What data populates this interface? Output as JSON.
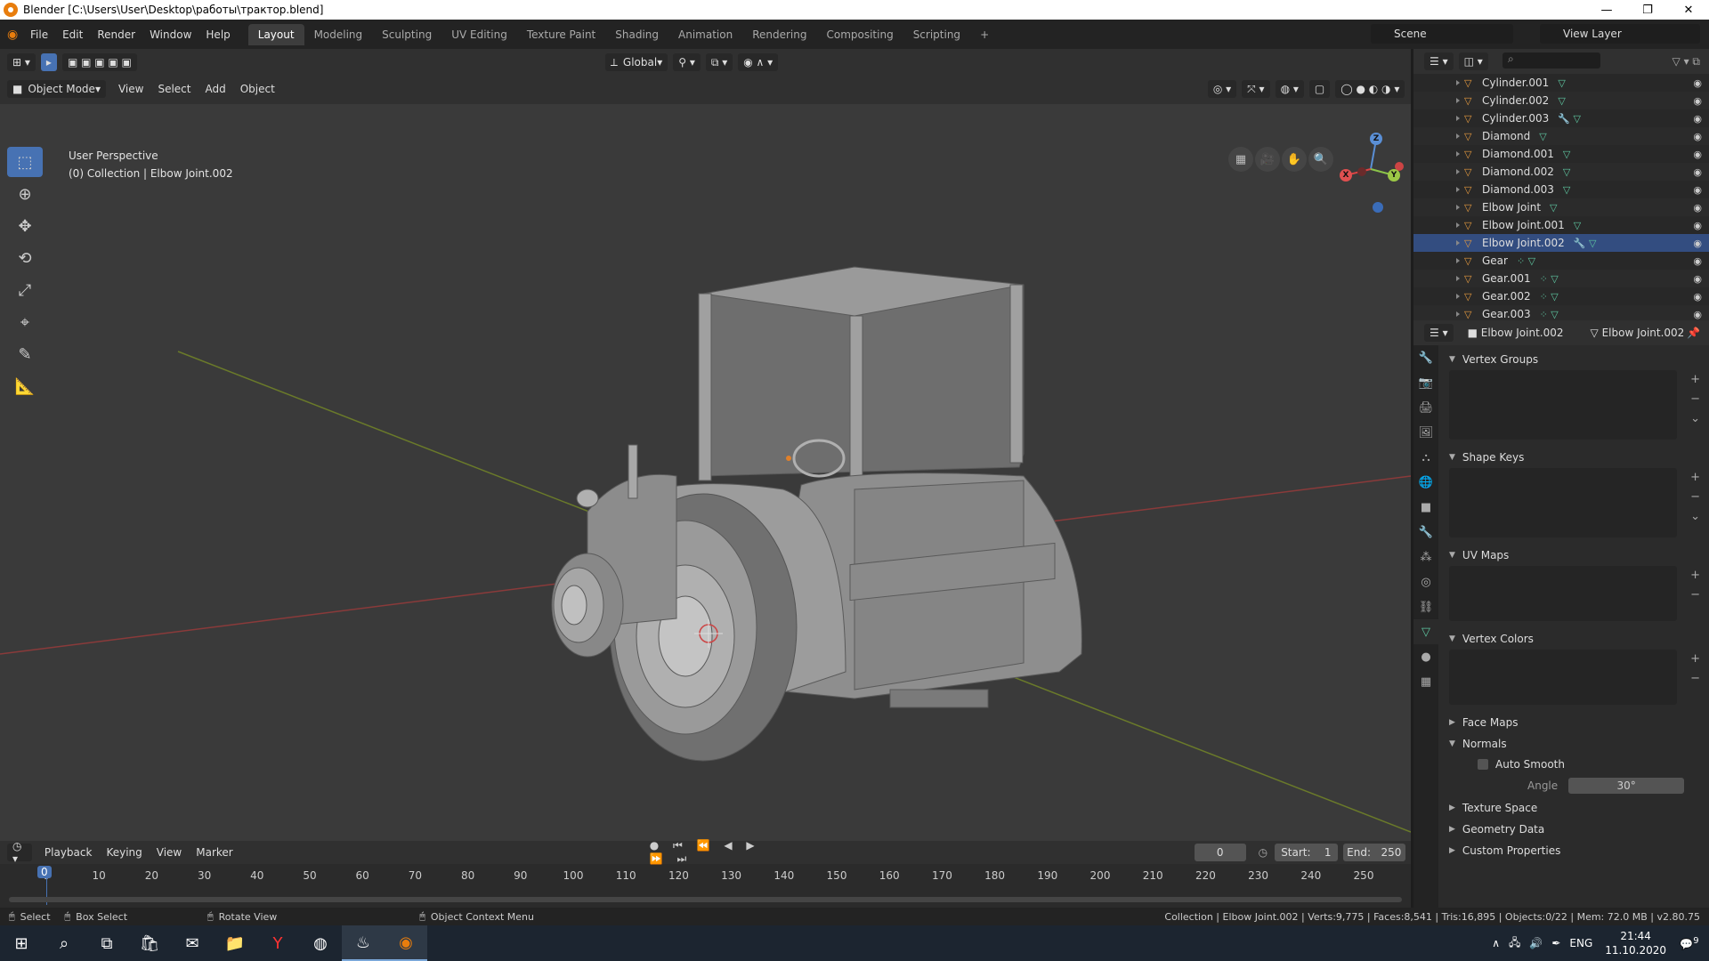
{
  "window": {
    "title": "Blender [C:\\Users\\User\\Desktop\\работы\\трактор.blend]",
    "minimize": "—",
    "maximize": "❐",
    "close": "✕"
  },
  "menu": [
    "File",
    "Edit",
    "Render",
    "Window",
    "Help"
  ],
  "workspaces": [
    "Layout",
    "Modeling",
    "Sculpting",
    "UV Editing",
    "Texture Paint",
    "Shading",
    "Animation",
    "Rendering",
    "Compositing",
    "Scripting"
  ],
  "active_workspace": "Layout",
  "scene": "Scene",
  "view_layer": "View Layer",
  "viewport": {
    "transform_orientation": "Global",
    "mode": "Object Mode",
    "menus": [
      "View",
      "Select",
      "Add",
      "Object"
    ],
    "info_line1": "User Perspective",
    "info_line2": "(0) Collection | Elbow Joint.002",
    "axes": {
      "x": "X",
      "y": "Y",
      "z": "Z"
    }
  },
  "outliner": {
    "items": [
      {
        "name": "Cylinder.001",
        "mods": "▽"
      },
      {
        "name": "Cylinder.002",
        "mods": "▽"
      },
      {
        "name": "Cylinder.003",
        "mods": "🔧 ▽"
      },
      {
        "name": "Diamond",
        "mods": "▽"
      },
      {
        "name": "Diamond.001",
        "mods": "▽"
      },
      {
        "name": "Diamond.002",
        "mods": "▽"
      },
      {
        "name": "Diamond.003",
        "mods": "▽"
      },
      {
        "name": "Elbow Joint",
        "mods": "▽"
      },
      {
        "name": "Elbow Joint.001",
        "mods": "▽"
      },
      {
        "name": "Elbow Joint.002",
        "mods": "🔧 ▽"
      },
      {
        "name": "Gear",
        "mods": "⁘ ▽"
      },
      {
        "name": "Gear.001",
        "mods": "⁘ ▽"
      },
      {
        "name": "Gear.002",
        "mods": "⁘ ▽"
      },
      {
        "name": "Gear.003",
        "mods": "⁘ ▽"
      }
    ]
  },
  "properties": {
    "object_name": "Elbow Joint.002",
    "mesh_name": "Elbow Joint.002",
    "panels": {
      "vertex_groups": "Vertex Groups",
      "shape_keys": "Shape Keys",
      "uv_maps": "UV Maps",
      "vertex_colors": "Vertex Colors",
      "face_maps": "Face Maps",
      "normals": "Normals",
      "auto_smooth": "Auto Smooth",
      "angle_label": "Angle",
      "angle_value": "30°",
      "texture_space": "Texture Space",
      "geometry_data": "Geometry Data",
      "custom_properties": "Custom Properties"
    }
  },
  "timeline": {
    "menus": [
      "Playback",
      "Keying",
      "View",
      "Marker"
    ],
    "current_frame": "0",
    "start_label": "Start:",
    "start": "1",
    "end_label": "End:",
    "end": "250",
    "ticks": [
      "0",
      "10",
      "20",
      "30",
      "40",
      "50",
      "60",
      "70",
      "80",
      "90",
      "100",
      "110",
      "120",
      "130",
      "140",
      "150",
      "160",
      "170",
      "180",
      "190",
      "200",
      "210",
      "220",
      "230",
      "240",
      "250"
    ]
  },
  "statusbar": {
    "select": "Select",
    "box_select": "Box Select",
    "rotate_view": "Rotate View",
    "context_menu": "Object Context Menu",
    "stats": "Collection | Elbow Joint.002 | Verts:9,775 | Faces:8,541 | Tris:16,895 | Objects:0/22 | Mem: 72.0 MB | v2.80.75"
  },
  "taskbar": {
    "lang": "ENG",
    "time": "21:44",
    "date": "11.10.2020",
    "notif": "9"
  }
}
